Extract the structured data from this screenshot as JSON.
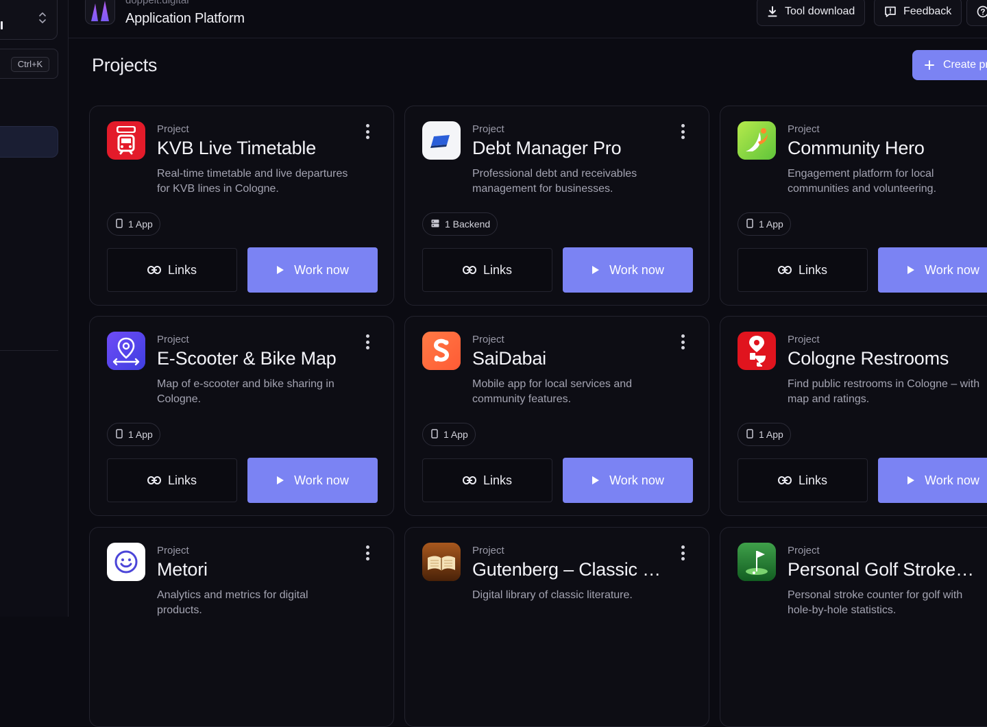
{
  "sidebar": {
    "search_shortcut": "Ctrl+K"
  },
  "header": {
    "org_name": "doppelt.digital",
    "app_title": "Application Platform",
    "tool_download_label": "Tool download",
    "feedback_label": "Feedback"
  },
  "page": {
    "title": "Projects",
    "create_label": "Create pr"
  },
  "colors": {
    "accent": "#7b83f3",
    "background": "#0b0b12",
    "card_border": "#23232e"
  },
  "projects": [
    {
      "kind": "Project",
      "name": "KVB Live Timetable",
      "description": "Real-time timetable and live departures for KVB lines in Cologne.",
      "badge": "1 App",
      "badge_icon": "phone-icon",
      "icon": "live-tram-icon",
      "links_label": "Links",
      "work_label": "Work now"
    },
    {
      "kind": "Project",
      "name": "Debt Manager Pro",
      "description": "Professional debt and receivables management for businesses.",
      "badge": "1 Backend",
      "badge_icon": "server-icon",
      "icon": "blue-card-icon",
      "links_label": "Links",
      "work_label": "Work now"
    },
    {
      "kind": "Project",
      "name": "Community Hero",
      "description": "Engagement platform for local communities and volunteering.",
      "badge": "1 App",
      "badge_icon": "phone-icon",
      "icon": "hero-leaf-icon",
      "links_label": "Links",
      "work_label": "Work now"
    },
    {
      "kind": "Project",
      "name": "E-Scooter & Bike Map",
      "description": "Map of e-scooter and bike sharing in Cologne.",
      "badge": "1 App",
      "badge_icon": "phone-icon",
      "icon": "map-pin-scooter-icon",
      "links_label": "Links",
      "work_label": "Work now"
    },
    {
      "kind": "Project",
      "name": "SaiDabai",
      "description": "Mobile app for local services and community features.",
      "badge": "1 App",
      "badge_icon": "phone-icon",
      "icon": "s-logo-icon",
      "links_label": "Links",
      "work_label": "Work now"
    },
    {
      "kind": "Project",
      "name": "Cologne Restrooms",
      "description": "Find public restrooms in Cologne – with map and ratings.",
      "badge": "1 App",
      "badge_icon": "phone-icon",
      "icon": "toilet-pin-icon",
      "links_label": "Links",
      "work_label": "Work now"
    },
    {
      "kind": "Project",
      "name": "Metori",
      "description": "Analytics and metrics for digital products.",
      "badge": "",
      "badge_icon": "",
      "icon": "smiley-icon",
      "links_label": "",
      "work_label": ""
    },
    {
      "kind": "Project",
      "name": "Gutenberg – Classic …",
      "description": "Digital library of classic literature.",
      "badge": "",
      "badge_icon": "",
      "icon": "open-book-icon",
      "links_label": "",
      "work_label": ""
    },
    {
      "kind": "Project",
      "name": "Personal Golf Stroke …",
      "description": "Personal stroke counter for golf with hole-by-hole statistics.",
      "badge": "",
      "badge_icon": "",
      "icon": "golf-flag-icon",
      "links_label": "",
      "work_label": ""
    }
  ]
}
